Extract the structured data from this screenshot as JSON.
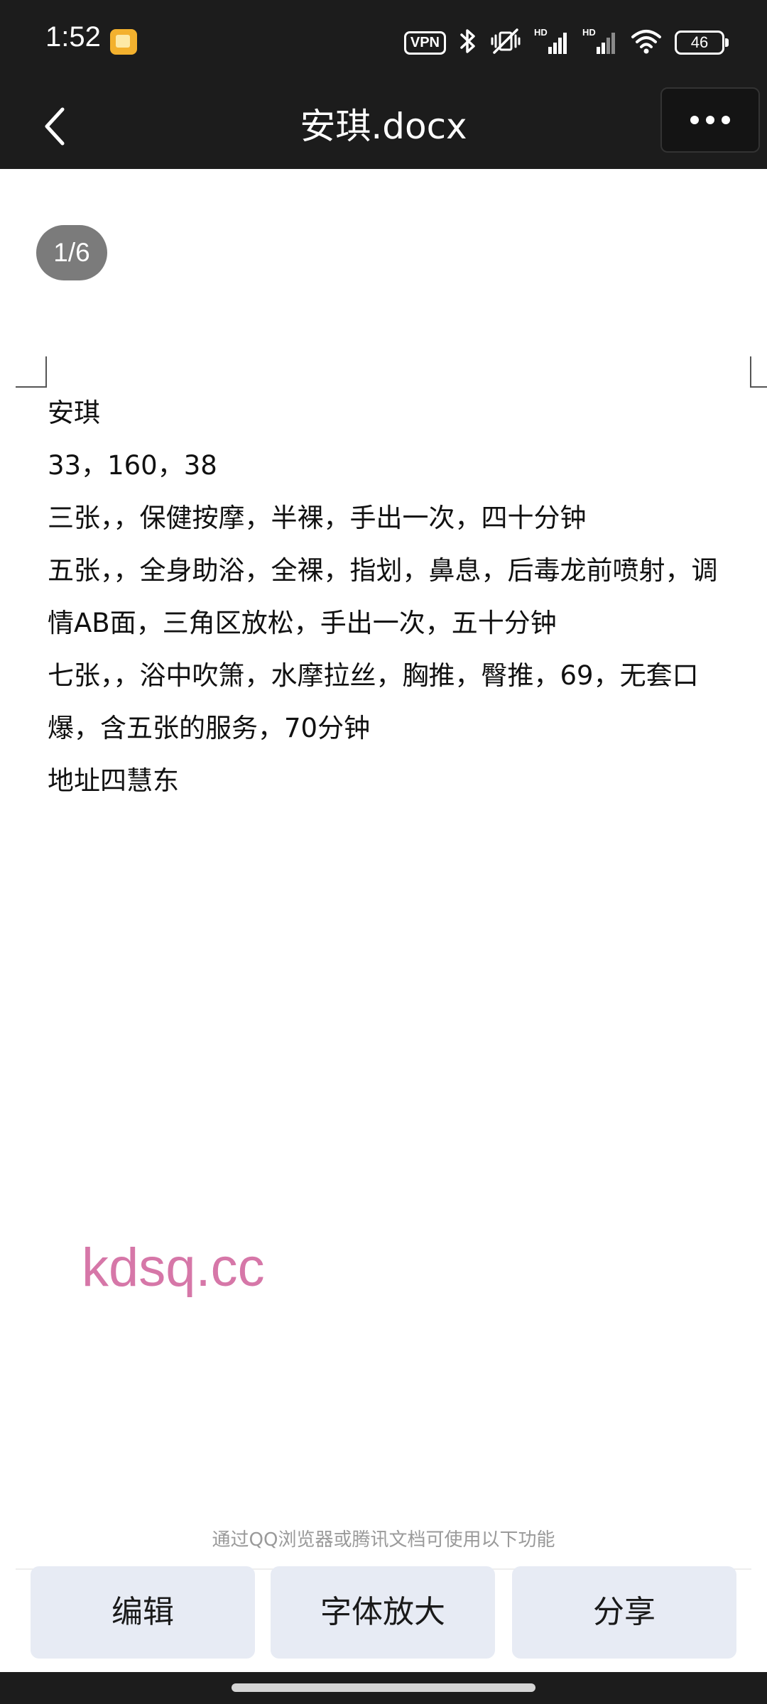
{
  "status_bar": {
    "time": "1:52",
    "vpn_label": "VPN",
    "network_label": "HD",
    "battery_level": "46",
    "icons": [
      "notification-app-icon",
      "vpn-icon",
      "bluetooth-icon",
      "mute-vibrate-icon",
      "signal-icon",
      "signal-icon",
      "wifi-icon",
      "battery-icon"
    ]
  },
  "header": {
    "title": "安琪.docx",
    "back_icon": "chevron-left-icon",
    "more_icon": "more-dots-icon"
  },
  "page_indicator": "1/6",
  "document": {
    "lines": [
      "安琪",
      "33，160，38",
      "三张，，保健按摩，半裸，手出一次，四十分钟",
      "五张，，全身助浴，全裸，指划，鼻息，后毒龙前喷射，调",
      "情AB面，三角区放松，手出一次，五十分钟",
      "七张，，浴中吹箫，水摩拉丝，胸推，臀推，69，无套口",
      "爆，含五张的服务，70分钟",
      "地址四慧东"
    ]
  },
  "watermark": "kdsq.cc",
  "footer": {
    "hint": "通过QQ浏览器或腾讯文档可使用以下功能",
    "buttons": {
      "edit": "编辑",
      "font": "字体放大",
      "share": "分享"
    }
  },
  "colors": {
    "bar_background": "#1c1c1c",
    "button_background": "#e7ebf4",
    "watermark": "#d677a8",
    "page_indicator": "#7b7b7b"
  }
}
